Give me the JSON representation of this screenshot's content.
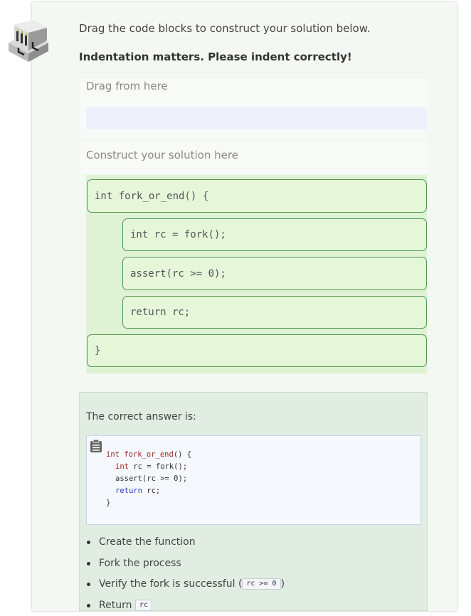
{
  "instructions": {
    "line1": "Drag the code blocks to construct your solution below.",
    "line2": "Indentation matters. Please indent correctly!"
  },
  "drag_area": {
    "label": "Drag from here"
  },
  "solution_area": {
    "label": "Construct your solution here",
    "blocks": [
      {
        "text": "int fork_or_end() {"
      },
      {
        "text": "int rc = fork();"
      },
      {
        "text": "assert(rc >= 0);"
      },
      {
        "text": "return rc;"
      },
      {
        "text": "}"
      }
    ]
  },
  "answer": {
    "label": "The correct answer is:",
    "code": [
      {
        "kw": "int fork_or_end",
        "rest": "() {"
      },
      {
        "kw": "int",
        "rest": " rc = fork();"
      },
      {
        "kw": "",
        "rest": "assert(rc >= 0);"
      },
      {
        "kw": "return",
        "rest": " rc;"
      },
      {
        "kw": "",
        "rest": "}"
      }
    ],
    "steps": [
      {
        "text": "Create the function"
      },
      {
        "text": "Fork the process"
      },
      {
        "text": "Verify the fork is successful (",
        "code": "rc >= 0",
        "after": ")"
      },
      {
        "text": "Return ",
        "code": "rc",
        "after": ""
      }
    ]
  },
  "colors": {
    "block_bg": "#e6f6d9",
    "block_border": "#4e9a4e",
    "keyword_red": "#a02828",
    "keyword_blue": "#2a35c8"
  },
  "icons": {
    "logo": "server-rack-logo-icon",
    "clipboard": "clipboard-icon"
  }
}
